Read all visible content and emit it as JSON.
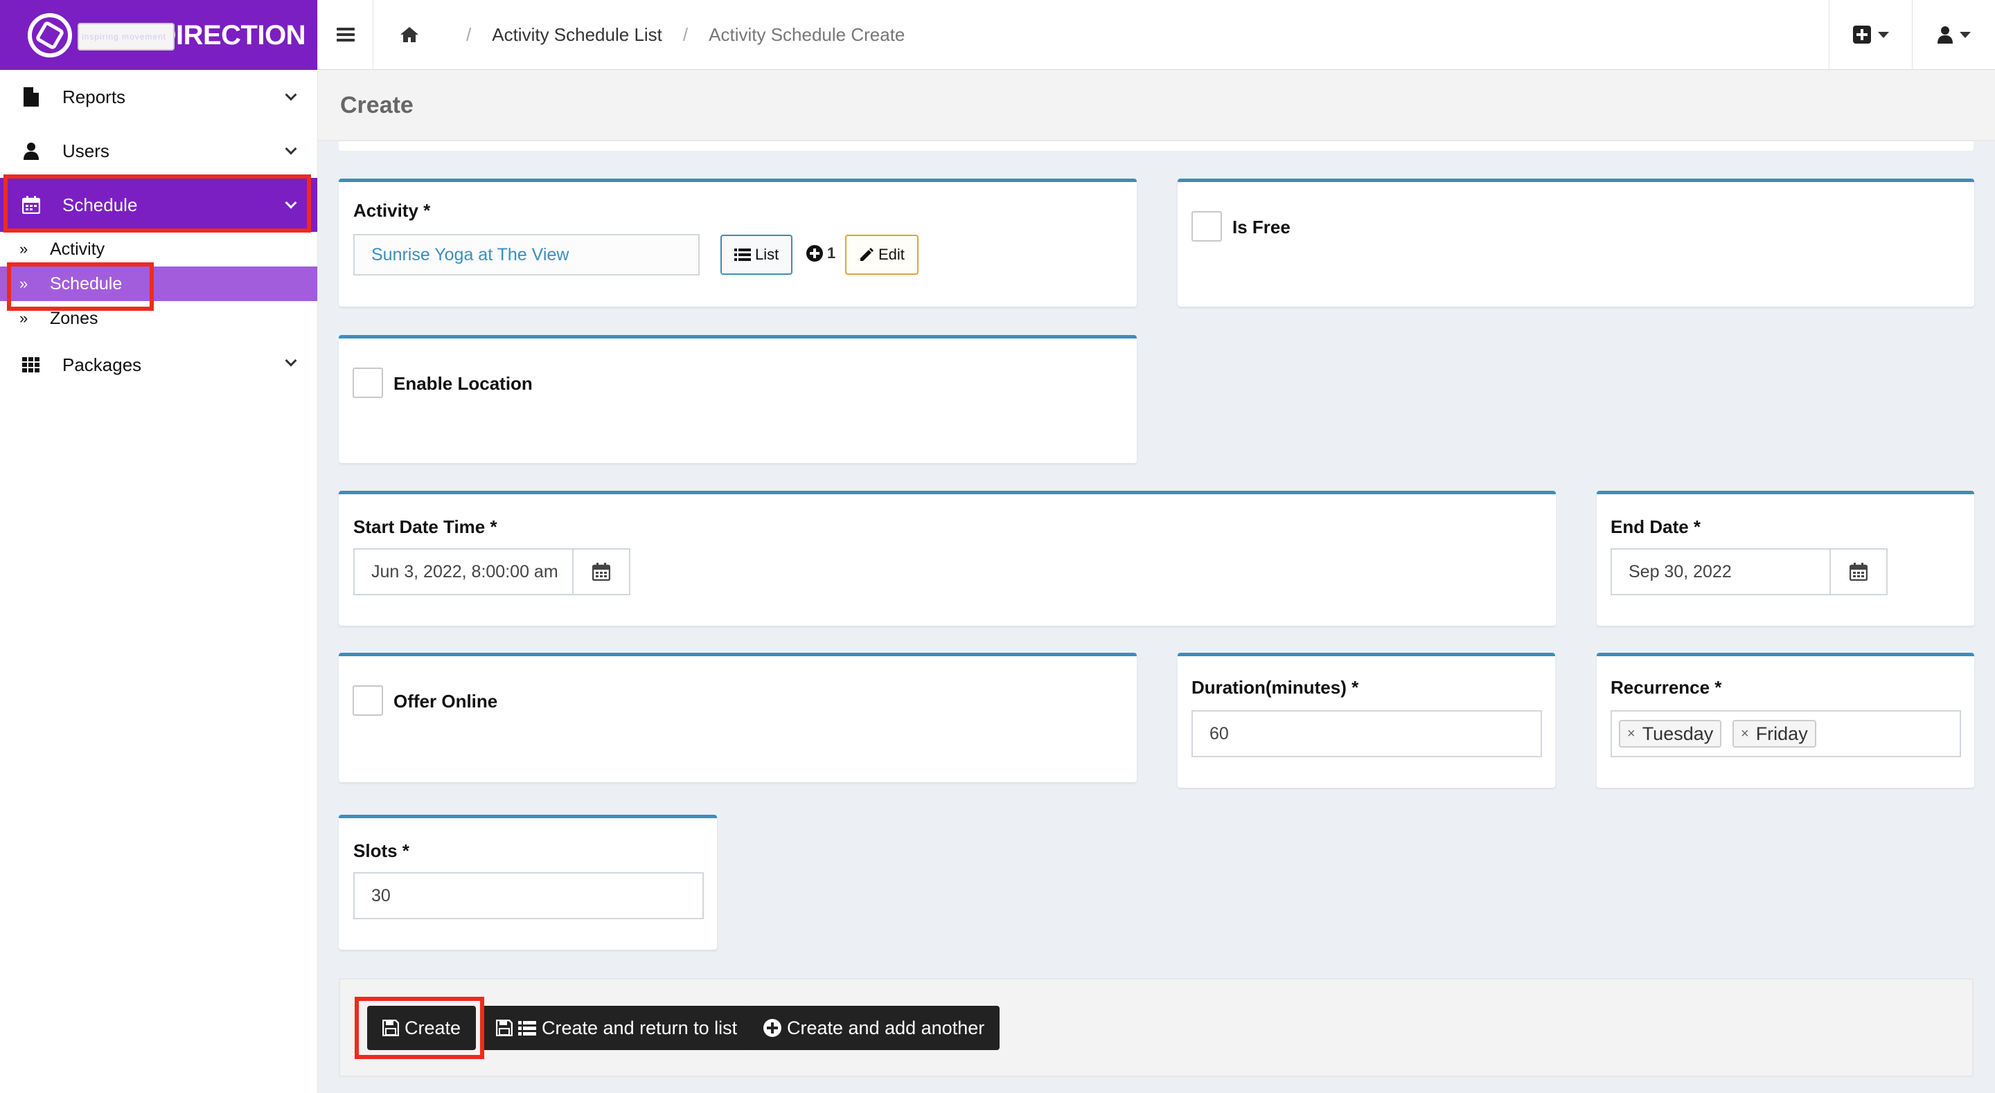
{
  "brand": {
    "name": "COREDIRECTION",
    "tagline": "inspiring movement",
    "color": "#7b1fc2"
  },
  "sidebar": {
    "items": [
      {
        "label": "Reports",
        "icon": "file-icon"
      },
      {
        "label": "Users",
        "icon": "user-icon"
      },
      {
        "label": "Schedule",
        "icon": "calendar-icon",
        "active": true
      },
      {
        "label": "Packages",
        "icon": "grid-icon"
      }
    ],
    "schedule_sub": [
      {
        "label": "Activity"
      },
      {
        "label": "Schedule",
        "active": true
      },
      {
        "label": "Zones"
      }
    ]
  },
  "topbar": {
    "breadcrumbs": [
      "Activity Schedule List",
      "Activity Schedule Create"
    ],
    "separator": "/"
  },
  "page": {
    "title": "Create"
  },
  "form": {
    "activity": {
      "label": "Activity *",
      "value": "Sunrise Yoga at The View",
      "list_label": "List",
      "count": "1",
      "edit_label": "Edit"
    },
    "is_free": {
      "label": "Is Free",
      "checked": false
    },
    "enable_location": {
      "label": "Enable Location",
      "checked": false
    },
    "start_date_time": {
      "label": "Start Date Time *",
      "value": "Jun 3, 2022, 8:00:00 am"
    },
    "end_date": {
      "label": "End Date *",
      "value": "Sep 30, 2022"
    },
    "offer_online": {
      "label": "Offer Online",
      "checked": false
    },
    "duration": {
      "label": "Duration(minutes) *",
      "value": "60"
    },
    "recurrence": {
      "label": "Recurrence *",
      "tags": [
        "Tuesday",
        "Friday"
      ],
      "remove_glyph": "×"
    },
    "slots": {
      "label": "Slots *",
      "value": "30"
    }
  },
  "actions": {
    "create": "Create",
    "create_return": "Create and return to list",
    "create_another": "Create and add another"
  },
  "colors": {
    "accent": "#3c8dbc",
    "highlight": "#ee2a1f",
    "submenu_active": "#a25ddc"
  }
}
